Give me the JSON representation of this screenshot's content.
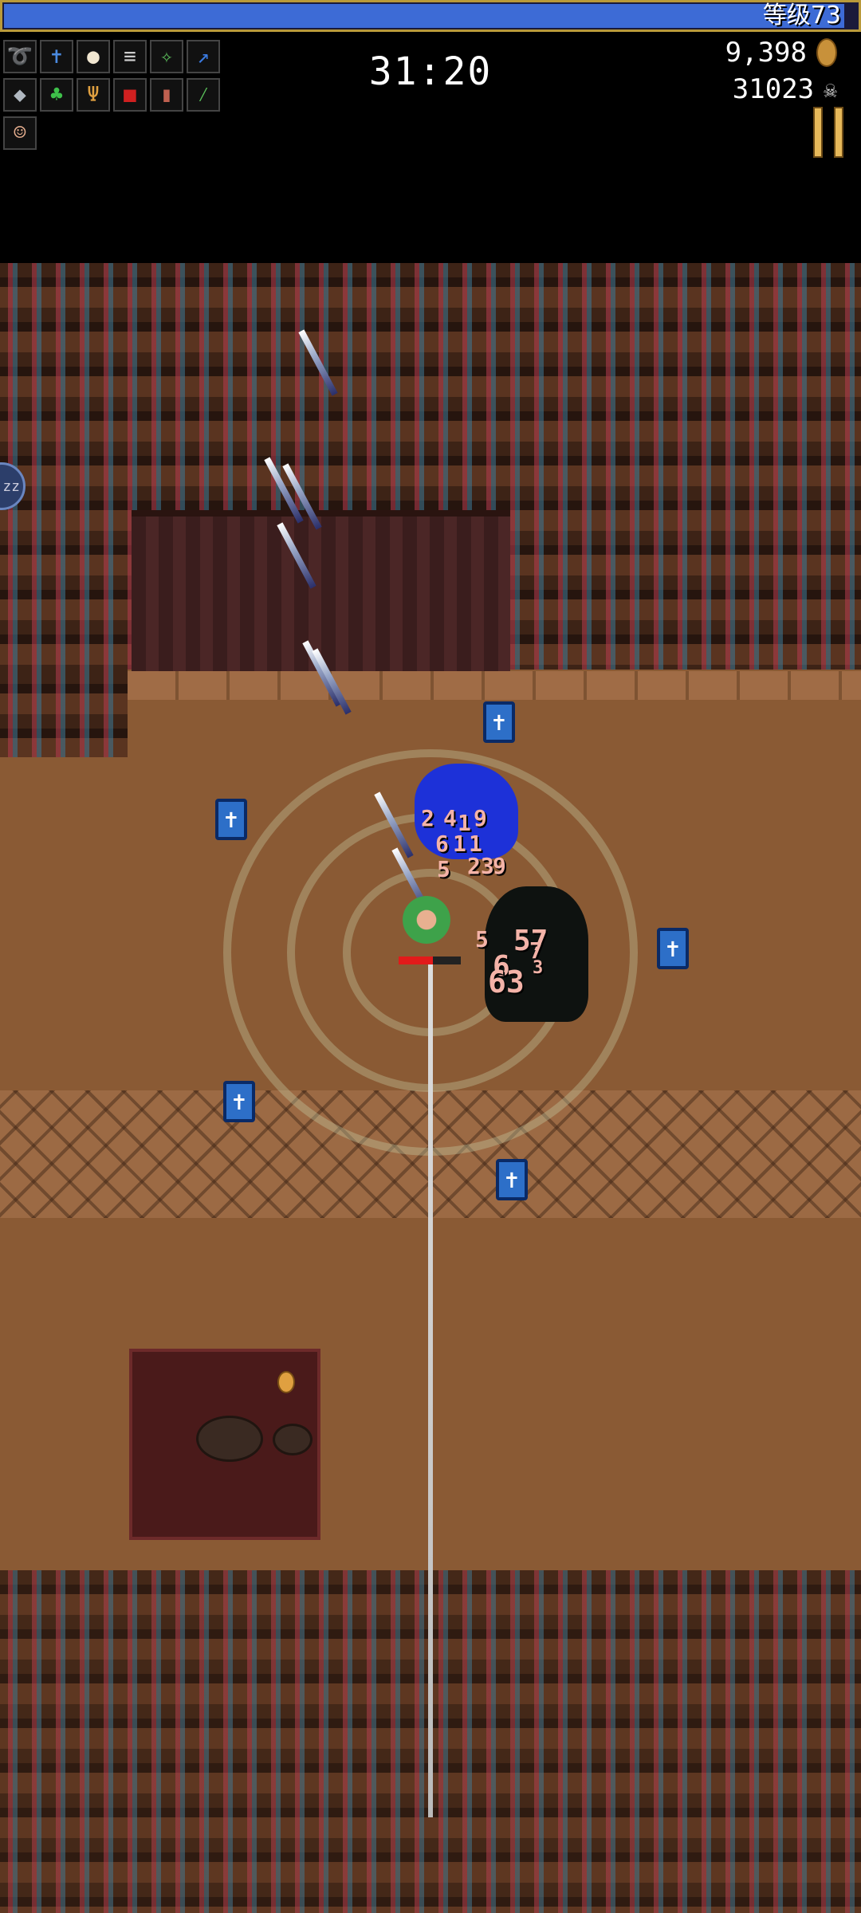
{
  "hud": {
    "level_label": "等级73",
    "xp_fraction": 0.985,
    "timer": "31:20",
    "gold": "9,398",
    "kills": "31023"
  },
  "inventory": {
    "row1": [
      "whip-icon",
      "bible-icon",
      "garlic-icon",
      "spellbinder-icon",
      "peachone-icon",
      "santa-water-icon"
    ],
    "row2": [
      "armor-icon",
      "clover-icon",
      "candelabrador-icon",
      "tome-icon",
      "bracer-icon",
      "feather-icon"
    ],
    "row3": [
      "character-portrait-icon"
    ]
  },
  "player": {
    "hp_fraction": 0.55
  },
  "damage_numbers": [
    "2",
    "4",
    "1",
    "9",
    "6",
    "1",
    "1",
    "5",
    "23",
    "9",
    "57",
    "5",
    "7",
    "6",
    "3",
    "63"
  ],
  "colors": {
    "xp_bar": "#3d6bd6",
    "xp_border": "#b99a3a",
    "hp": "#e21a1a",
    "pickup": "#2d6fc8",
    "pause": "#e7b95a"
  }
}
